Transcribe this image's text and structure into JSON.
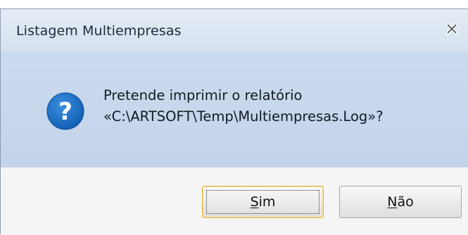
{
  "dialog": {
    "title": "Listagem Multiempresas",
    "close_icon": "close-icon",
    "icon": "question-icon",
    "icon_glyph": "?",
    "message_line1": "Pretende imprimir o relatório",
    "message_line2": "«C:\\ARTSOFT\\Temp\\Multiempresas.Log»?",
    "buttons": {
      "yes_mnemonic": "S",
      "yes_rest": "im",
      "no_mnemonic": "N",
      "no_rest": "ão"
    },
    "colors": {
      "icon_blue": "#1a6ec8",
      "content_bg": "#c8d8ec",
      "default_button_border": "#e0b440"
    }
  }
}
